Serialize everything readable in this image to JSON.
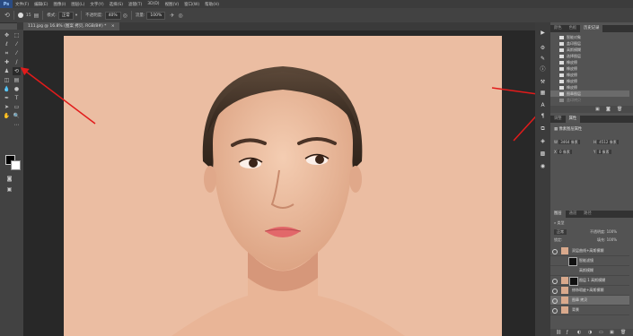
{
  "menubar": {
    "logo": "Ps",
    "items": [
      "文件(F)",
      "编辑(E)",
      "图像(I)",
      "图层(L)",
      "文字(Y)",
      "选择(S)",
      "滤镜(T)",
      "3D(D)",
      "视图(V)",
      "窗口(W)",
      "帮助(H)"
    ]
  },
  "options": {
    "size": "15",
    "mode_label": "模式:",
    "mode_value": "正常",
    "opacity_label": "不透明度:",
    "opacity_value": "40%",
    "flow_label": "流量:",
    "flow_value": "100%"
  },
  "document": {
    "tab_title": "111.jpg @ 16.8% (图案 拷贝, RGB/8#) *",
    "close": "×"
  },
  "history_panel": {
    "tabs": [
      "颜色",
      "色板",
      "历史记录"
    ],
    "items": [
      "智能对象",
      "盖印图层",
      "高斯模糊",
      "选择图层",
      "橡皮擦",
      "橡皮擦",
      "橡皮擦",
      "橡皮擦",
      "橡皮擦",
      "图章图层",
      "盖印拷贝"
    ]
  },
  "properties_panel": {
    "tabs": [
      "调整",
      "属性"
    ],
    "title": "像素图层属性",
    "w_label": "W",
    "w_value": "3464 像素",
    "h_label": "H",
    "h_value": "4512 像素",
    "x_label": "X",
    "x_value": "0 像素",
    "y_label": "Y",
    "y_value": "0 像素"
  },
  "layers_panel": {
    "tabs": [
      "图层",
      "通道",
      "路径"
    ],
    "kind": "类型",
    "blend": "正常",
    "opacity_label": "不透明度:",
    "opacity_value": "100%",
    "lock_label": "锁定:",
    "fill_label": "填充:",
    "fill_value": "100%",
    "layers": [
      "双层曲线+高斯模糊",
      "智能滤镜",
      "高斯模糊",
      "图层 1 高斯模糊",
      "修饰瑕疵+高斯模糊",
      "图章 拷贝",
      "背景"
    ]
  },
  "colors": {
    "canvas_bg": "#ebbda2",
    "workspace": "#282828",
    "panel": "#535353",
    "arrow": "#e21b1b"
  }
}
